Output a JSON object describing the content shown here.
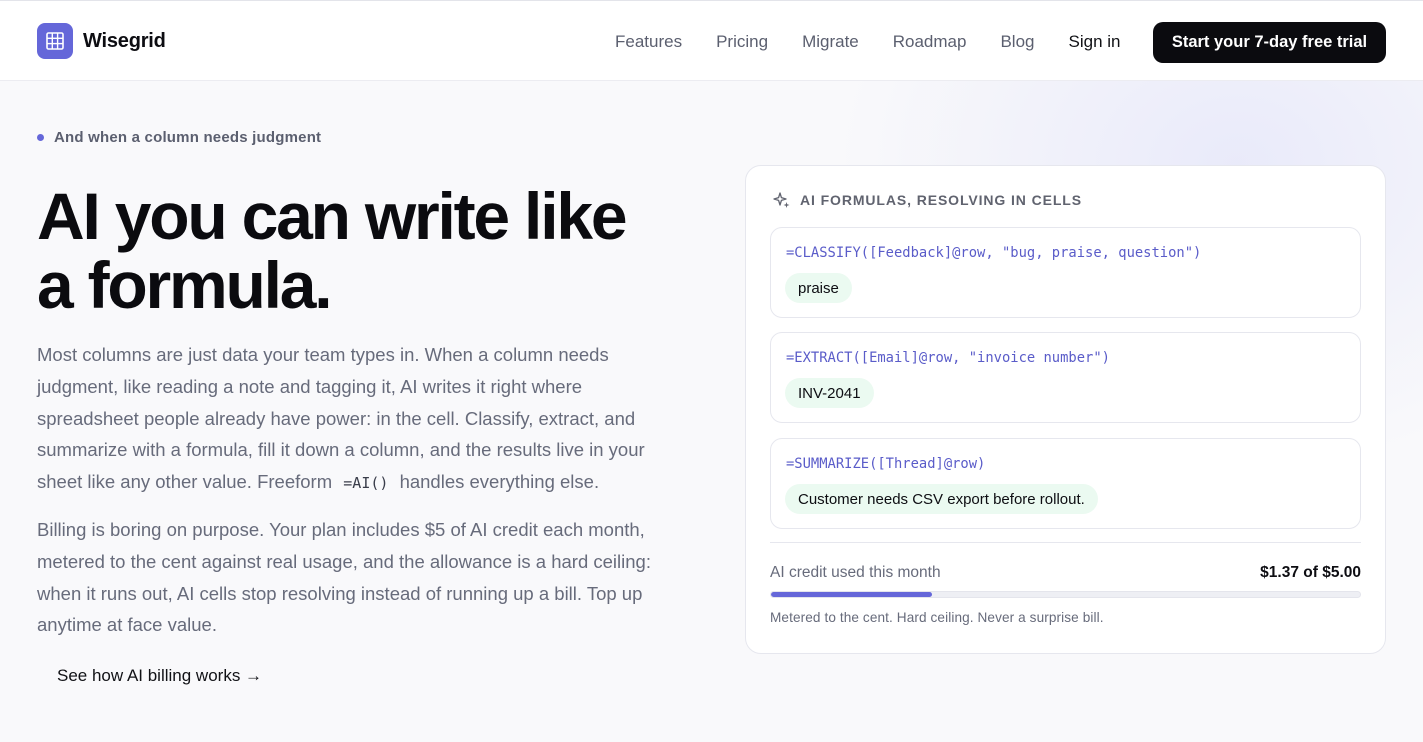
{
  "brand": {
    "name": "Wisegrid",
    "icon": "grid-icon",
    "accent": "#6567d9"
  },
  "nav": {
    "items": [
      "Features",
      "Pricing",
      "Migrate",
      "Roadmap",
      "Blog"
    ],
    "signin": "Sign in",
    "cta": "Start your 7-day free trial"
  },
  "hero": {
    "eyebrow": "And when a column needs judgment",
    "headline_line1": "AI you can write like",
    "headline_line2": "a formula.",
    "para1_before": "Most columns are just data your team types in. When a column needs judgment, like reading a note and tagging it, AI writes it right where spreadsheet people already have power: in the cell. Classify, extract, and summarize with a formula, fill it down a column, and the results live in your sheet like any other value. Freeform",
    "para1_code": "=AI()",
    "para1_after": "handles everything else.",
    "para2": "Billing is boring on purpose. Your plan includes $5 of AI credit each month, metered to the cent against real usage, and the allowance is a hard ceiling: when it runs out, AI cells stop resolving instead of running up a bill. Top up anytime at face value.",
    "billing_link": "See how AI billing works →"
  },
  "card": {
    "label": "AI FORMULAS, RESOLVING IN CELLS",
    "label_icon": "sparkle-icon",
    "cells": [
      {
        "formula": "=CLASSIFY([Feedback]@row, \"bug, praise, question\")",
        "result": "praise"
      },
      {
        "formula": "=EXTRACT([Email]@row, \"invoice number\")",
        "result": "INV-2041"
      },
      {
        "formula": "=SUMMARIZE([Thread]@row)",
        "result": "Customer needs CSV export before rollout."
      }
    ],
    "usage_label": "AI credit used this month",
    "usage_value": "$1.37 of $5.00",
    "usage_used": 1.37,
    "usage_total": 5.0,
    "usage_note": "Metered to the cent. Hard ceiling. Never a surprise bill."
  }
}
